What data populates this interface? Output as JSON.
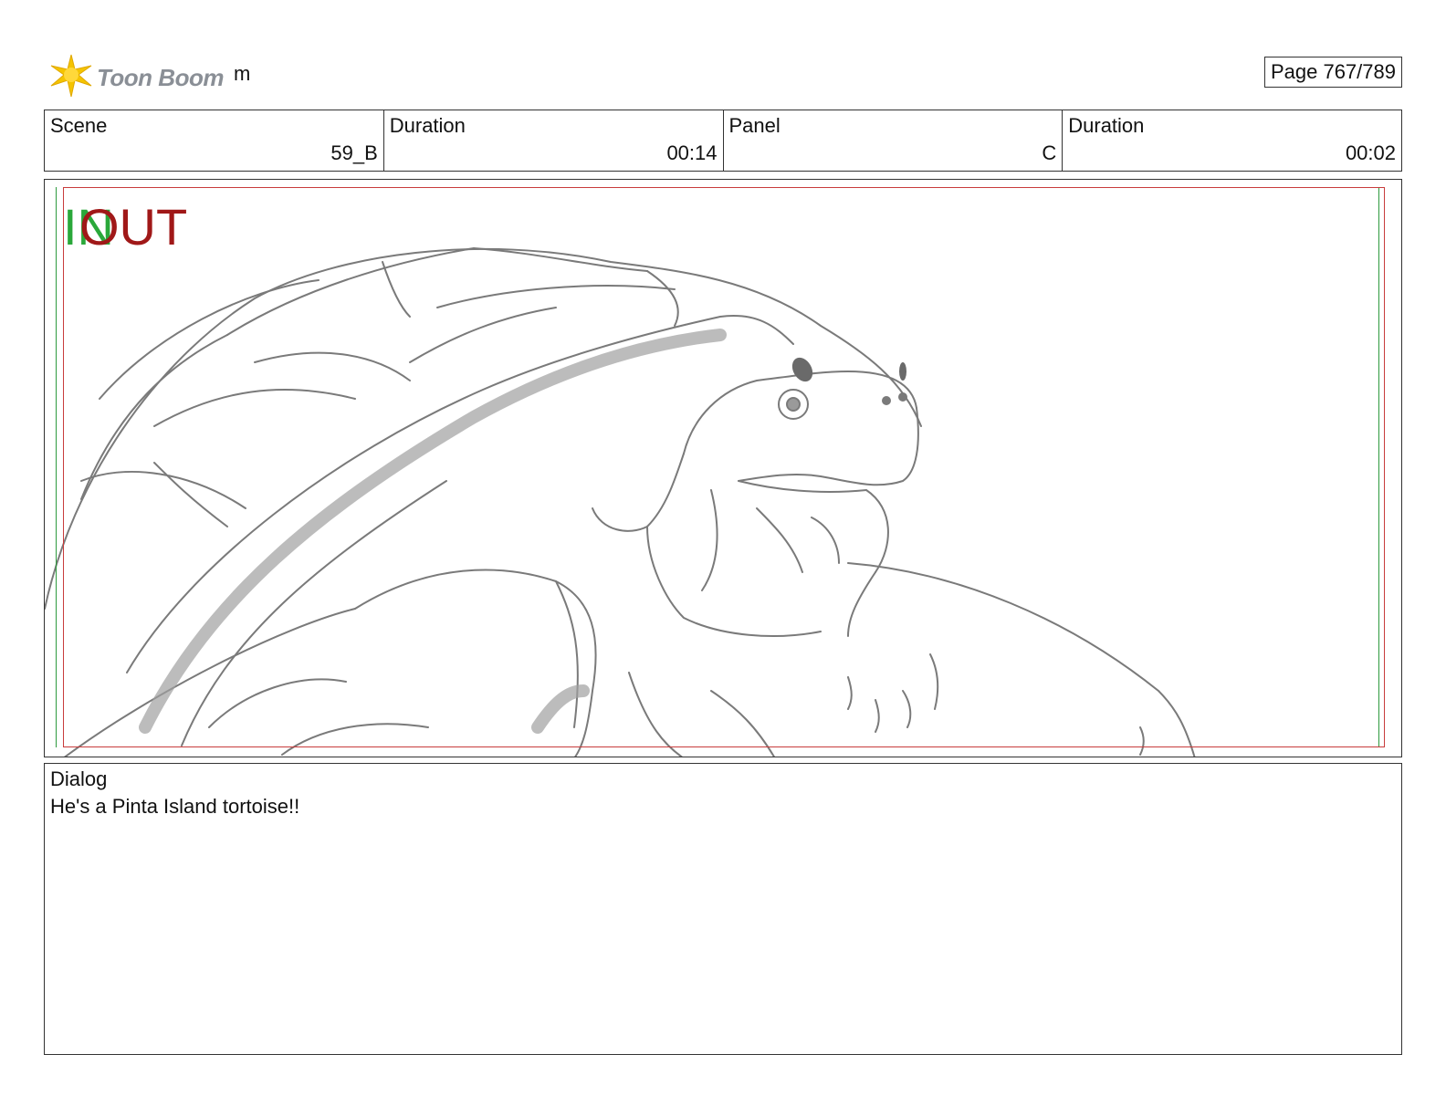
{
  "header": {
    "logo_text": "Toon Boom",
    "project_name": "m",
    "page": "Page 767/789"
  },
  "info": {
    "scene_label": "Scene",
    "scene_value": "59_B",
    "scene_duration_label": "Duration",
    "scene_duration_value": "00:14",
    "panel_label": "Panel",
    "panel_value": "C",
    "panel_duration_label": "Duration",
    "panel_duration_value": "00:02"
  },
  "panel_markers": {
    "in_text": "IN",
    "out_text": "OUT",
    "in_color": "#2aa83a",
    "out_color": "#a01818"
  },
  "dialog": {
    "label": "Dialog",
    "text": "He's a Pinta Island tortoise!!"
  },
  "colors": {
    "frame_red": "#c83c3c",
    "frame_green": "#2e9a3e",
    "sketch_line": "#7a7a7a",
    "logo_yellow": "#f5c400"
  }
}
